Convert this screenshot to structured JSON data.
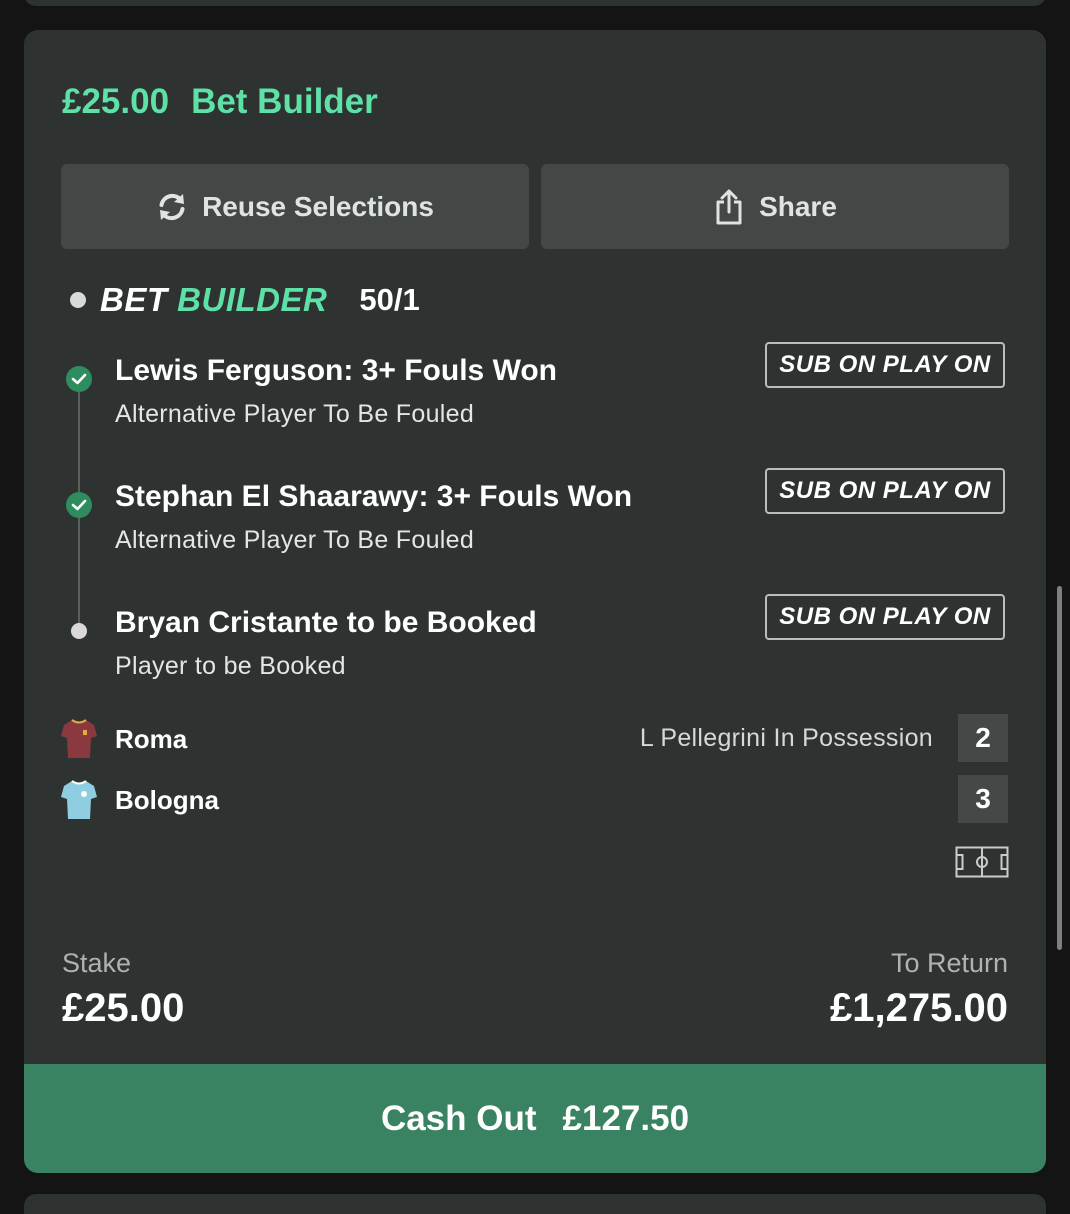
{
  "bet": {
    "stake_header": "£25.00",
    "type_header": "Bet Builder"
  },
  "actions": {
    "reuse_label": "Reuse Selections",
    "share_label": "Share"
  },
  "bet_builder": {
    "logo_part1": "BET",
    "logo_part2": "BUILDER",
    "odds": "50/1"
  },
  "selections": [
    {
      "title": "Lewis Ferguson: 3+ Fouls Won",
      "subtitle": "Alternative Player To Be Fouled",
      "badge": "SUB ON PLAY ON",
      "status": "won"
    },
    {
      "title": "Stephan El Shaarawy: 3+ Fouls Won",
      "subtitle": "Alternative Player To Be Fouled",
      "badge": "SUB ON PLAY ON",
      "status": "won"
    },
    {
      "title": "Bryan Cristante to be Booked",
      "subtitle": "Player to be Booked",
      "badge": "SUB ON PLAY ON",
      "status": "pending"
    }
  ],
  "match": {
    "home": {
      "name": "Roma",
      "score": "2",
      "kit_color": "#8a3a3f"
    },
    "away": {
      "name": "Bologna",
      "score": "3",
      "kit_color": "#8fcde0"
    },
    "status_text": "L Pellegrini In Possession"
  },
  "totals": {
    "stake_label": "Stake",
    "stake_value": "£25.00",
    "return_label": "To Return",
    "return_value": "£1,275.00"
  },
  "cashout": {
    "label": "Cash Out",
    "amount": "£127.50"
  },
  "colors": {
    "accent": "#5de1a7",
    "card": "#2e3230",
    "button": "#434846",
    "cashout": "#3a8362",
    "check": "#2f8c5e"
  }
}
